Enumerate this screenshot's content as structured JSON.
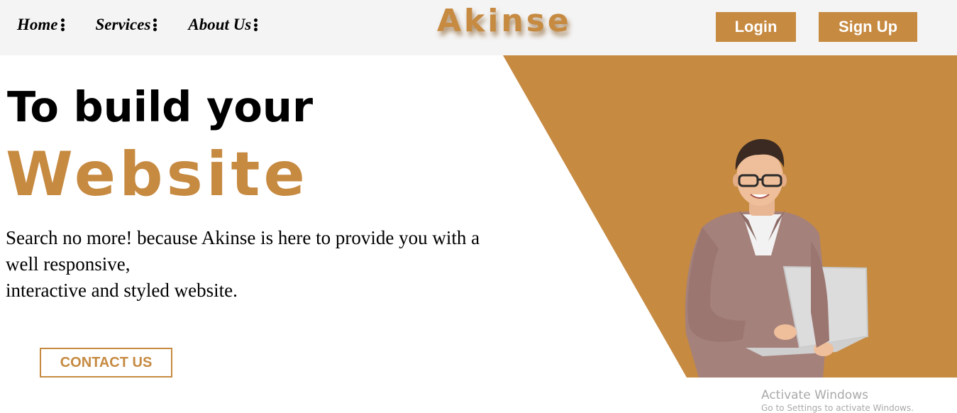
{
  "nav": {
    "items": [
      {
        "label": "Home"
      },
      {
        "label": "Services"
      },
      {
        "label": "About Us"
      }
    ],
    "brand": "Akinse",
    "login_label": "Login",
    "signup_label": "Sign Up"
  },
  "hero": {
    "headline_line1": "To build your",
    "headline_line2": "Website",
    "tagline_lines": [
      "Search no more! because Akinse is here to provide you with a",
      "well responsive,",
      "interactive and styled website."
    ],
    "contact_label": "CONTACT US"
  },
  "watermark": {
    "title": "Activate Windows",
    "subtitle": "Go to Settings to activate Windows."
  },
  "colors": {
    "accent": "#c68a41",
    "navbar_bg": "#f4f4f4",
    "text": "#000000"
  },
  "icons": {
    "nav_more": "vertical-ellipsis-icon"
  }
}
